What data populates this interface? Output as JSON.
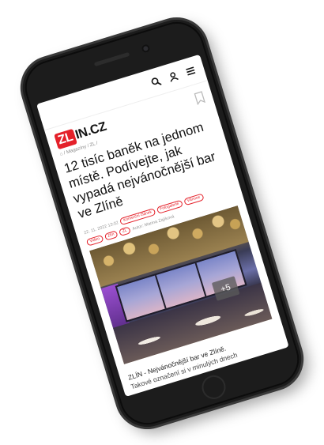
{
  "header": {
    "icons": [
      "search-icon",
      "user-icon",
      "menu-icon"
    ]
  },
  "brand": {
    "logo_prefix": "ZL",
    "logo_suffix": "IN.CZ",
    "accent": "#e4212a"
  },
  "breadcrumb": "⌂ / Magazíny / ZL /",
  "article": {
    "title": "12 tisíc baněk na jednom místě. Podívejte, jak vypadá nejvánočnější bar ve Zlíně",
    "date": "22. 11. 2022 13:02",
    "tags": [
      "Komerční článek",
      "Fotogalerie",
      "Vánoce",
      "Video",
      "Zlín",
      "ZL"
    ],
    "author": "Autor: Marina Zajíková",
    "photo_more": "+5",
    "perex_line1": "ZLÍN - Nejvánočnější bar ve Zlíně.",
    "perex_line2": "Takové označení si v minulých dnech"
  }
}
